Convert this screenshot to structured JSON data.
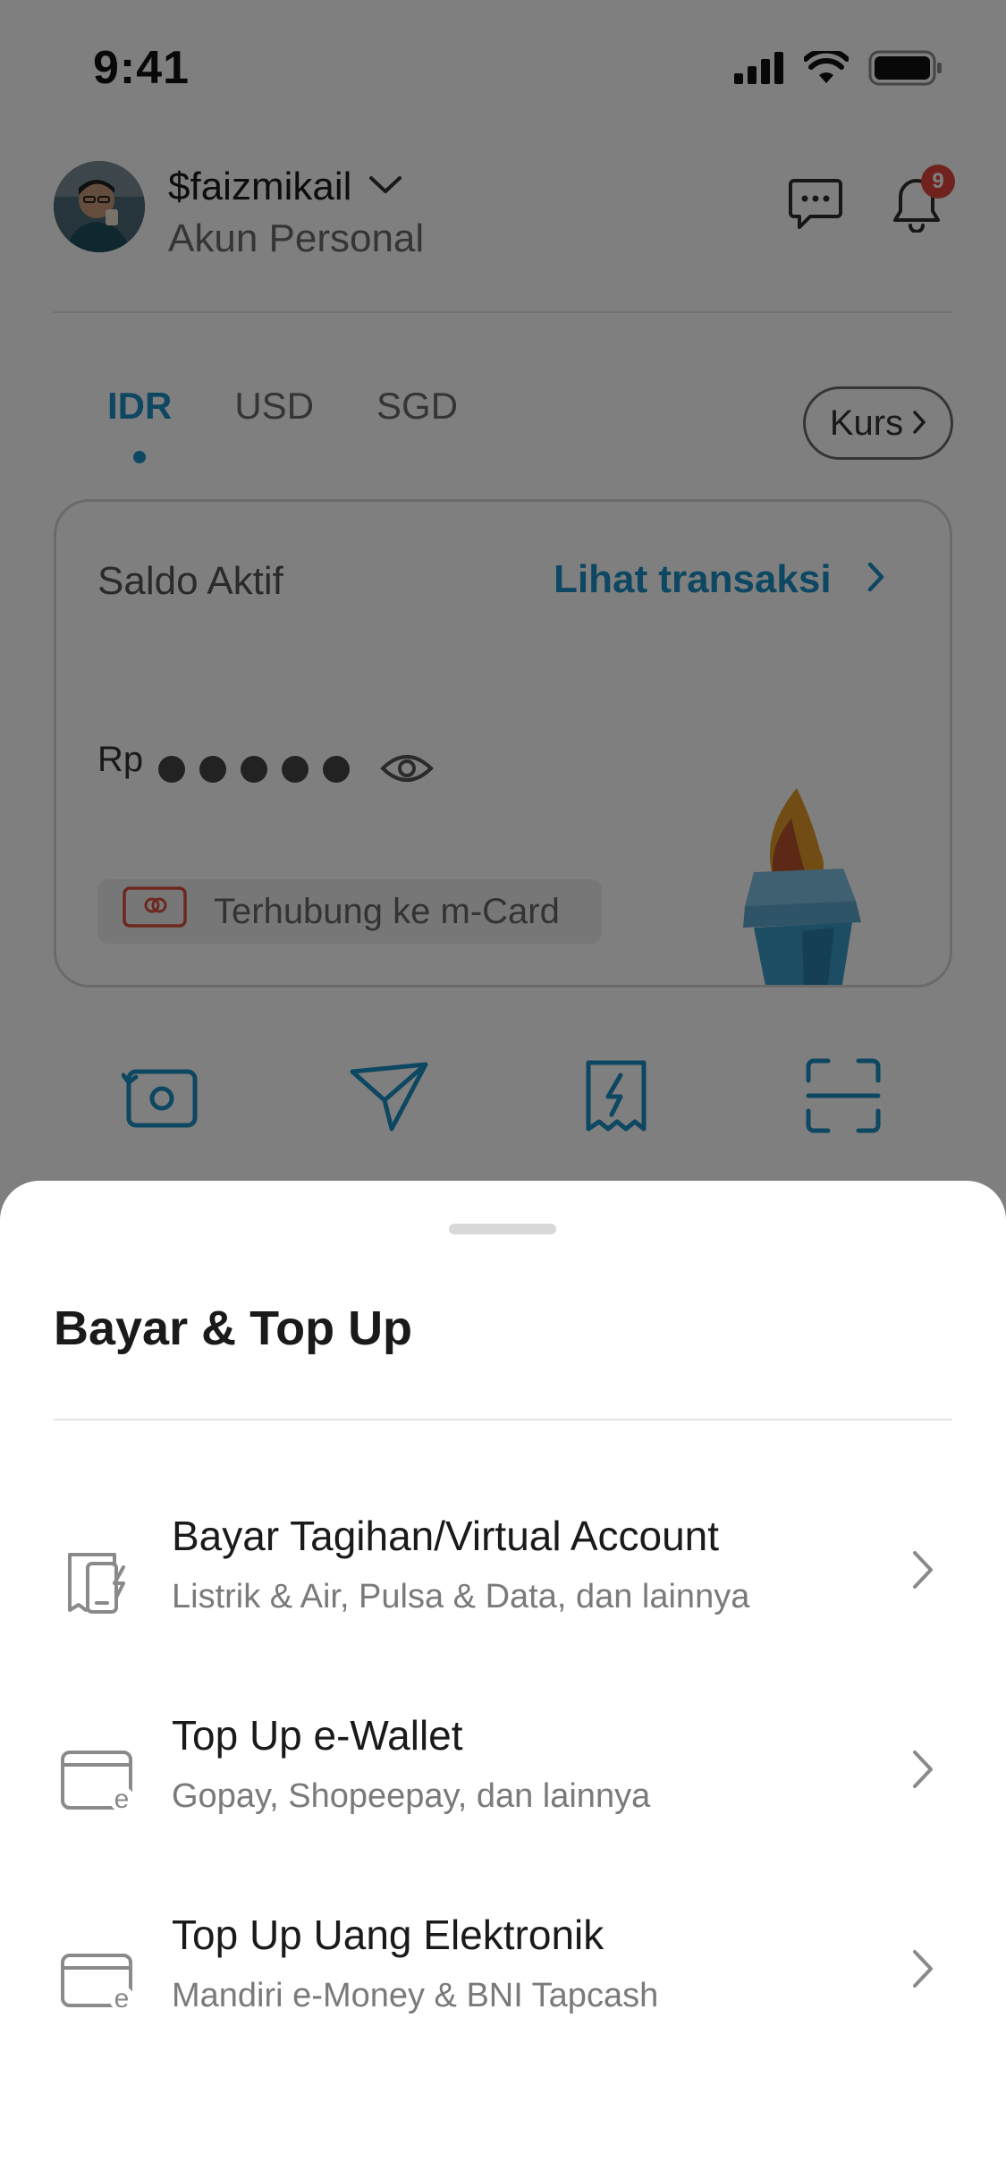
{
  "status_bar": {
    "time": "9:41"
  },
  "header": {
    "username": "$faizmikail",
    "account_type": "Akun Personal",
    "notification_count": "9"
  },
  "currency_tabs": {
    "items": [
      {
        "label": "IDR",
        "active": true
      },
      {
        "label": "USD",
        "active": false
      },
      {
        "label": "SGD",
        "active": false
      }
    ],
    "kurs_label": "Kurs"
  },
  "balance_card": {
    "label": "Saldo Aktif",
    "link": "Lihat transaksi",
    "currency_prefix": "Rp",
    "masked": true,
    "mcard_label": "Terhubung ke m-Card"
  },
  "colors": {
    "accent": "#1b8fc4",
    "badge": "#e0463c",
    "overlay": "rgba(0,0,0,0.5)"
  },
  "bottom_sheet": {
    "title": "Bayar & Top Up",
    "items": [
      {
        "title": "Bayar Tagihan/Virtual Account",
        "subtitle": "Listrik & Air, Pulsa & Data, dan lainnya",
        "icon": "bill-phone-icon"
      },
      {
        "title": "Top Up e-Wallet",
        "subtitle": "Gopay, Shopeepay, dan lainnya",
        "icon": "ewallet-icon"
      },
      {
        "title": "Top Up Uang Elektronik",
        "subtitle": "Mandiri e-Money & BNI Tapcash",
        "icon": "ecard-icon"
      }
    ]
  }
}
